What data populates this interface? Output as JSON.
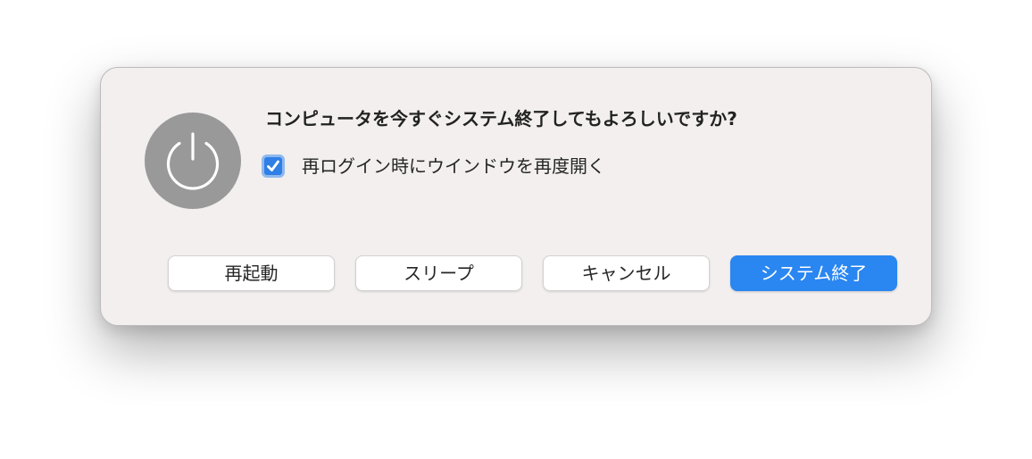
{
  "dialog": {
    "title": "コンピュータを今すぐシステム終了してもよろしいですか?",
    "icon": "power-icon",
    "reopen_windows": {
      "label": "再ログイン時にウインドウを再度開く",
      "checked": true
    },
    "buttons": {
      "restart": "再起動",
      "sleep": "スリープ",
      "cancel": "キャンセル",
      "shutdown": "システム終了"
    }
  },
  "colors": {
    "accent": "#2a86f0",
    "icon_background": "#999999",
    "dialog_background": "#f2efee"
  }
}
